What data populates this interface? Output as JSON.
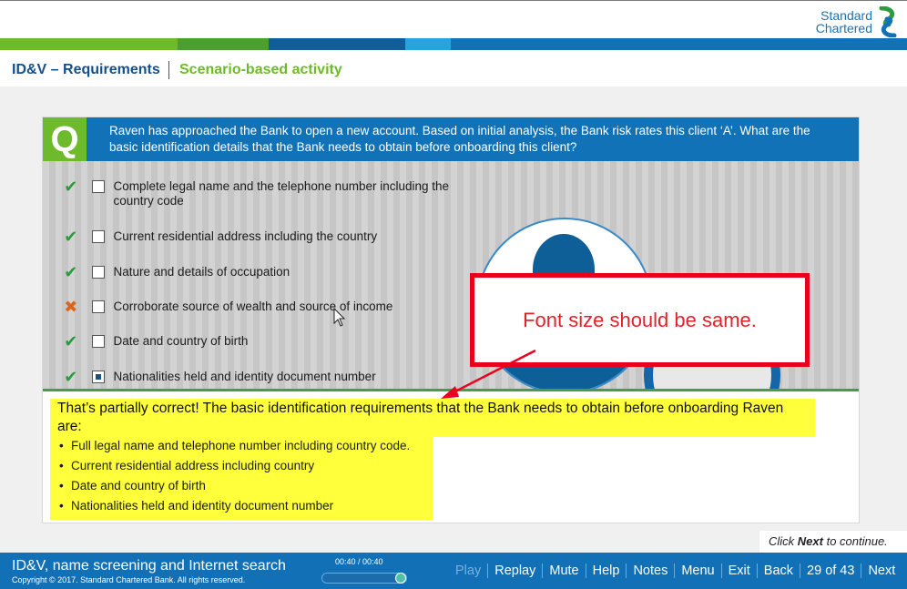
{
  "header": {
    "logo_line1": "Standard",
    "logo_line2": "Chartered",
    "stripe_colors": [
      "#6dbb2c",
      "#4a9f2f",
      "#0f5e9a",
      "#1272b8",
      "#29a3de",
      "#1272b8"
    ]
  },
  "titlebar": {
    "course": "ID&V – Requirements",
    "activity": "Scenario-based activity"
  },
  "question": {
    "badge": "Q",
    "text": "Raven has approached the Bank to open a new account. Based on initial analysis, the Bank risk rates this client ‘A’. What are the basic identification details that the Bank needs to obtain before onboarding this client?"
  },
  "options": [
    {
      "mark": "✔",
      "status": "correct",
      "checked": false,
      "label": "Complete legal name and the telephone number including the country code"
    },
    {
      "mark": "✔",
      "status": "correct",
      "checked": false,
      "label": "Current residential address including the country"
    },
    {
      "mark": "✔",
      "status": "correct",
      "checked": false,
      "label": "Nature and details of occupation"
    },
    {
      "mark": "✖",
      "status": "incorrect",
      "checked": false,
      "label": "Corroborate source of wealth and source of income"
    },
    {
      "mark": "✔",
      "status": "correct",
      "checked": false,
      "label": "Date and country of birth"
    },
    {
      "mark": "✔",
      "status": "correct",
      "checked": true,
      "label": "Nationalities held and identity document number"
    }
  ],
  "annotation": {
    "text": "Font size should be same."
  },
  "feedback": {
    "heading": "That’s partially correct! The basic identification requirements that the Bank needs to obtain before onboarding Raven are:",
    "items": [
      "Full legal name and telephone number including country code.",
      "Current residential address including country",
      "Date and country of birth",
      "Nationalities held and identity document number"
    ]
  },
  "continue_hint": {
    "pre": "Click ",
    "strong": "Next",
    "post": " to continue."
  },
  "footer": {
    "title": "ID&V, name screening and Internet search",
    "copyright": "Copyright © 2017. Standard Chartered Bank. All rights reserved.",
    "timecode": "00:40 / 00:40",
    "progress_fraction": 1.0,
    "nav": {
      "play": "Play",
      "replay": "Replay",
      "mute": "Mute",
      "help": "Help",
      "notes": "Notes",
      "menu": "Menu",
      "exit": "Exit",
      "back": "Back",
      "page": "29 of 43",
      "next": "Next"
    }
  }
}
